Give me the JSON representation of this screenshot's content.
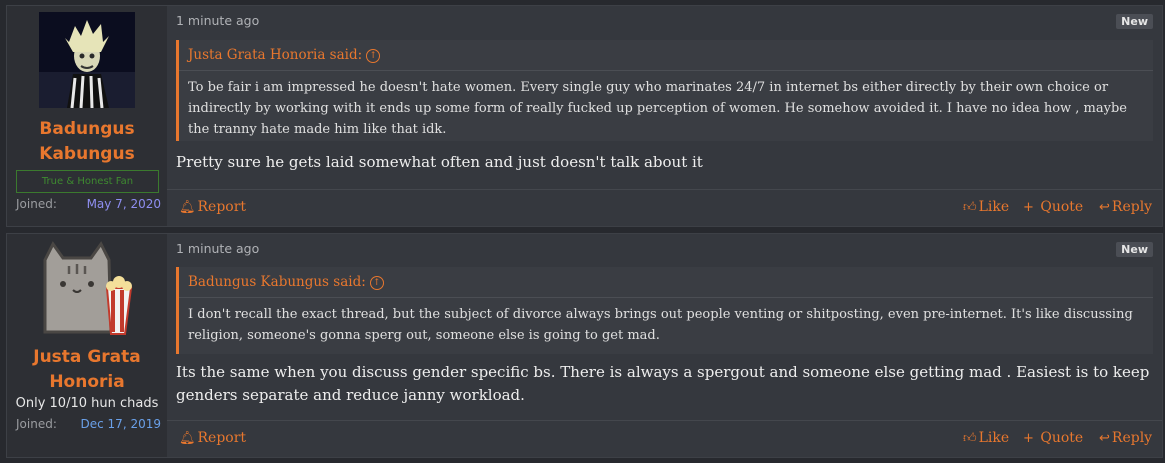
{
  "posts": [
    {
      "username_line1": "Badungus",
      "username_line2": "Kabungus",
      "user_title": "True & Honest Fan",
      "joined_label": "Joined:",
      "joined_date": "May 7, 2020",
      "time": "1 minute ago",
      "badge": "New",
      "quote_author": "Justa Grata Honoria said:",
      "quote_text": "To be fair i am impressed he doesn't hate women. Every single guy who marinates 24/7 in internet bs either directly by their own choice or indirectly by working with it ends up some form of really fucked up perception of women. He somehow avoided it. I have no idea how , maybe the tranny hate made him like that idk.",
      "body": "Pretty sure he gets laid somewhat often and just doesn't talk about it",
      "actions": {
        "report": "Report",
        "like": "Like",
        "quote": "Quote",
        "reply": "Reply"
      },
      "avatar_icon": "beetlejuice-avatar-icon"
    },
    {
      "username_line1": "Justa Grata",
      "username_line2": "Honoria",
      "user_title": "Only 10/10 hun chads",
      "joined_label": "Joined:",
      "joined_date": "Dec 17, 2019",
      "time": "1 minute ago",
      "badge": "New",
      "quote_author": "Badungus Kabungus said:",
      "quote_text": "I don't recall the exact thread, but the subject of divorce always brings out people venting or shitposting, even pre-internet. It's like discussing religion, someone's gonna sperg out, someone else is going to get mad.",
      "body": "Its the same when you discuss gender specific bs. There is always a spergout and someone else getting mad . Easiest is to keep genders separate and reduce janny workload.",
      "actions": {
        "report": "Report",
        "like": "Like",
        "quote": "Quote",
        "reply": "Reply"
      },
      "avatar_icon": "pusheen-popcorn-avatar-icon"
    }
  ],
  "colors": {
    "accent": "#e8772e",
    "background": "#27292e",
    "post": "#35383e",
    "sidebar": "#2d2f34"
  }
}
